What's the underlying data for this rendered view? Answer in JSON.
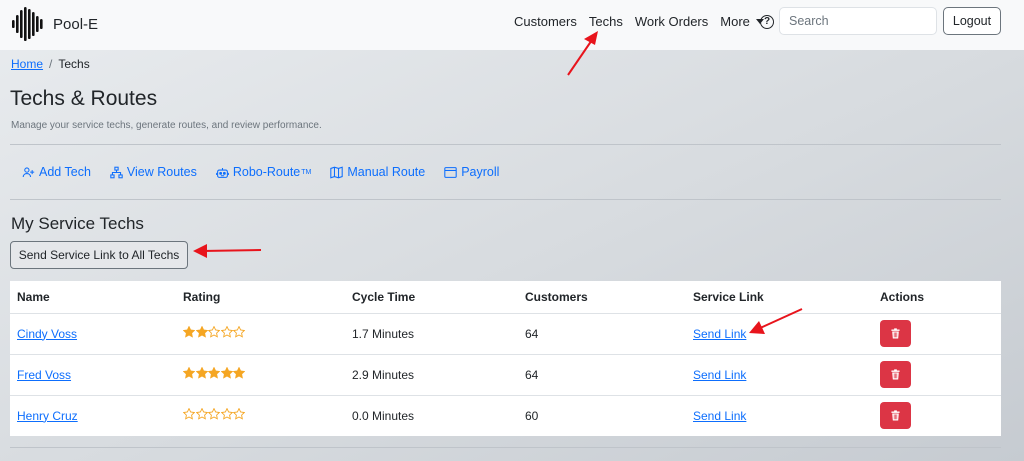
{
  "brand": {
    "name": "Pool-E"
  },
  "nav": {
    "items": [
      "Customers",
      "Techs",
      "Work Orders"
    ],
    "more_label": "More",
    "help_symbol": "?",
    "search_placeholder": "Search",
    "logout_label": "Logout"
  },
  "breadcrumb": {
    "home": "Home",
    "separator": "/",
    "current": "Techs"
  },
  "page": {
    "title": "Techs & Routes",
    "subtitle": "Manage your service techs, generate routes, and review performance."
  },
  "actions": [
    {
      "label": "Add Tech",
      "icon": "person-plus-icon"
    },
    {
      "label": "View Routes",
      "icon": "diagram-icon"
    },
    {
      "label": "Robo-Route",
      "icon": "robot-icon",
      "superscript": "TM"
    },
    {
      "label": "Manual Route",
      "icon": "map-icon"
    },
    {
      "label": "Payroll",
      "icon": "window-icon"
    }
  ],
  "section": {
    "title": "My Service Techs",
    "send_all_label": "Send Service Link to All Techs"
  },
  "table": {
    "headers": [
      "Name",
      "Rating",
      "Cycle Time",
      "Customers",
      "Service Link",
      "Actions"
    ],
    "rows": [
      {
        "name": "Cindy Voss",
        "rating": 2,
        "cycle_time": "1.7 Minutes",
        "customers": "64",
        "link": "Send Link"
      },
      {
        "name": "Fred Voss",
        "rating": 5,
        "cycle_time": "2.9 Minutes",
        "customers": "64",
        "link": "Send Link"
      },
      {
        "name": "Henry Cruz",
        "rating": 0,
        "cycle_time": "0.0 Minutes",
        "customers": "60",
        "link": "Send Link"
      }
    ],
    "max_rating": 5
  },
  "colors": {
    "accent": "#0d6efd",
    "danger": "#dc3545",
    "star": "#f5a623",
    "annotation_arrow": "#e8141c"
  }
}
